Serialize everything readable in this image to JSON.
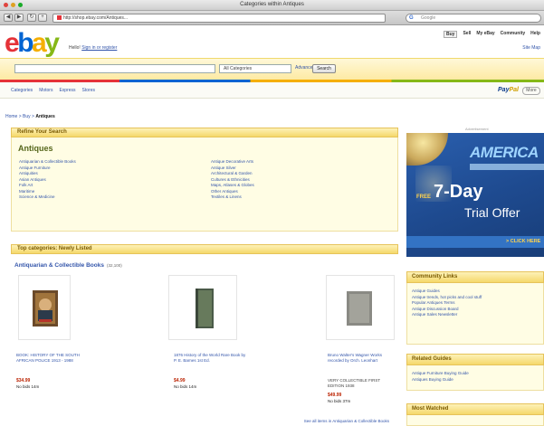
{
  "browser": {
    "window_title": "Categories within Antiques",
    "url": "http://shop.ebay.com/Antiques...",
    "search_placeholder": "Google"
  },
  "header": {
    "greeting_prefix": "Hello!",
    "greeting_link": "Sign in or register",
    "top_links": [
      "Buy",
      "Sell",
      "My eBay",
      "Community",
      "Help"
    ],
    "site_map": "Site Map",
    "category_select": "All Categories",
    "advanced": "Advanced",
    "search_button": "Search"
  },
  "nav": {
    "items": [
      "Categories",
      "Motors",
      "Express",
      "Stores"
    ],
    "paypal": [
      "Pay",
      "Pal"
    ],
    "trailing": "More"
  },
  "breadcrumb": {
    "prefix": "Home > Buy > ",
    "current": "Antiques"
  },
  "refine": {
    "header": "Refine Your Search",
    "title": "Antiques",
    "col1": [
      "Antiquarian & Collectible Books",
      "Antique Furniture",
      "Antiquities",
      "Asian Antiques",
      "Folk Art",
      "Maritime",
      "Science & Medicine"
    ],
    "col2": [
      "Antique Decorative Arts",
      "Antique Silver",
      "Architectural & Garden",
      "Cultures & Ethnicities",
      "Maps, Atlases & Globes",
      "Other Antiques",
      "Textiles & Linens"
    ]
  },
  "top_categories": {
    "header": "Top categories: Newly Listed",
    "subhead": "Antiquarian & Collectible Books",
    "subhead_more": "(32,100)",
    "items": [
      {
        "title": "BOOK: HISTORY OF THE SOUTH AFRICAN POLICE 1913 - 1988",
        "price": "$34.99",
        "bids": "No bids 14m"
      },
      {
        "title": "1876 History of the World Rare Book by P. E. Barnes 1st Ed.",
        "price": "$4.99",
        "bids": "No bids 14m"
      },
      {
        "title": "Bruno Walter's Wagner Works recorded by Orch. Leonhart",
        "extra": "VERY COLLECTIBLE FIRST EDITION 1938",
        "price": "$49.99",
        "bids": "No bids 37m"
      }
    ],
    "see_all": "See all items in Antiquarian & Collectible Books"
  },
  "ad": {
    "label": "Advertisement",
    "brand": "AMERICA",
    "free": "FREE",
    "day": "7-Day",
    "trial": "Trial Offer",
    "click": "> CLICK HERE"
  },
  "community": {
    "header": "Community Links",
    "links": [
      "Antique Guides",
      "Antique trends, hot picks and cool stuff",
      "Popular Antiques Terms",
      "Antique Discussion Board",
      "Antique Sales Newsletter"
    ]
  },
  "guides": {
    "header": "Related Guides",
    "links": [
      "Antique Furniture Buying Guide",
      "Antiques Buying Guide"
    ]
  },
  "most_watched": {
    "header": "Most Watched"
  },
  "colors": {
    "ebay_e": "#e53238",
    "ebay_b": "#0064d2",
    "ebay_a": "#f5af02",
    "ebay_y": "#86b817",
    "link": "#3355aa",
    "price": "#bb2200"
  }
}
